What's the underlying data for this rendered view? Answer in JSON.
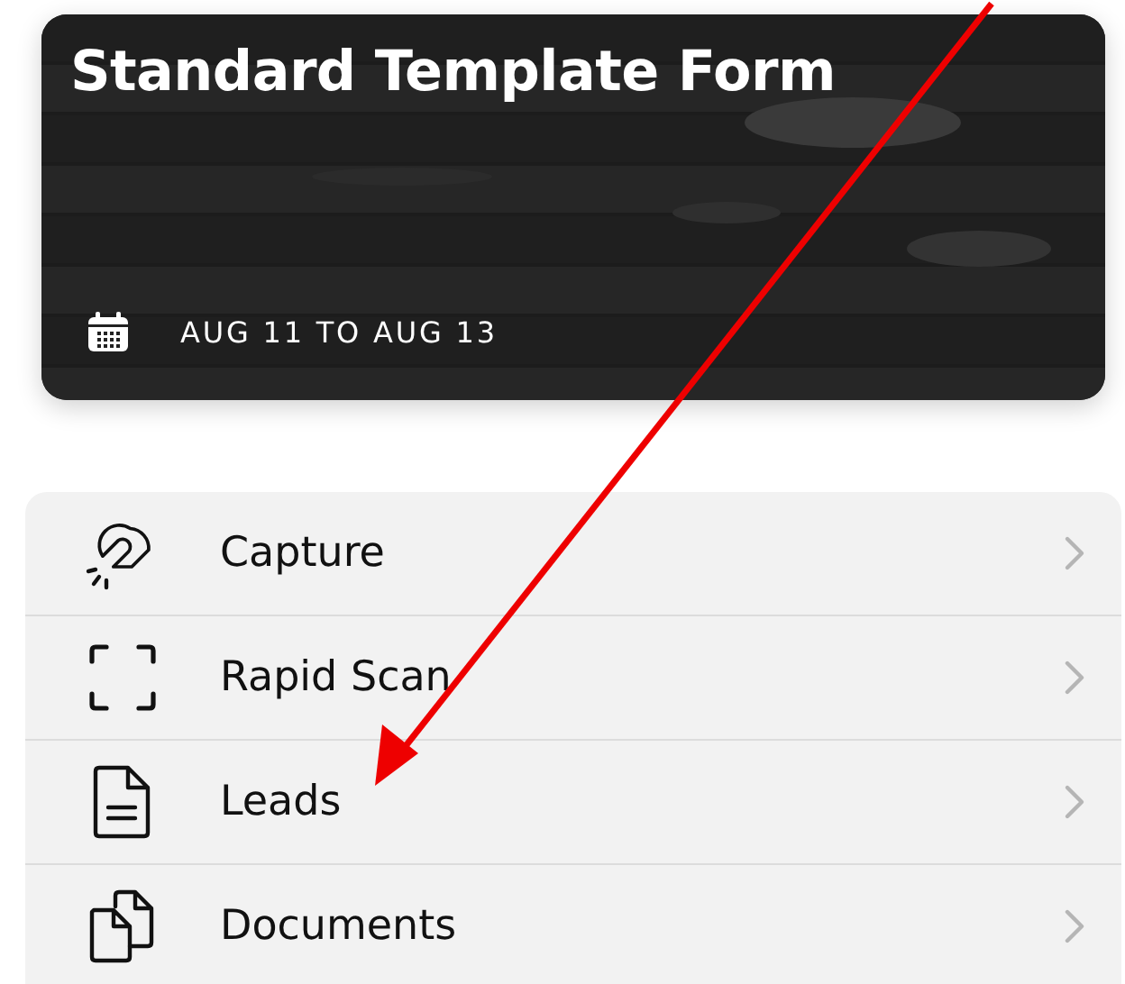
{
  "event": {
    "title": "Standard Template Form",
    "date_range": "AUG 11 TO AUG 13"
  },
  "menu": [
    {
      "label": "Capture"
    },
    {
      "label": "Rapid Scan"
    },
    {
      "label": "Leads"
    },
    {
      "label": "Documents"
    }
  ]
}
